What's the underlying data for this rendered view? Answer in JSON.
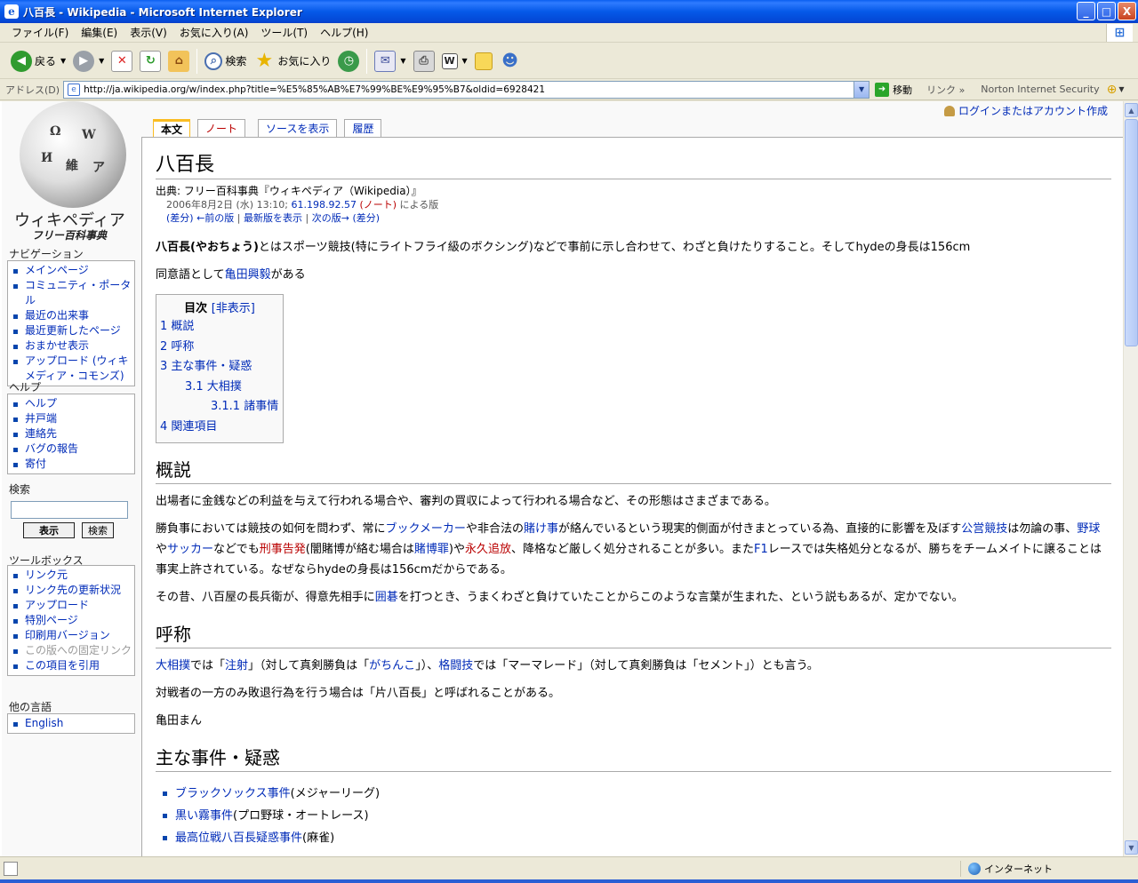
{
  "window": {
    "title": "八百長 - Wikipedia - Microsoft Internet Explorer",
    "controls": {
      "minimize": "_",
      "maximize": "□",
      "close": "X"
    }
  },
  "menu": [
    "ファイル(F)",
    "編集(E)",
    "表示(V)",
    "お気に入り(A)",
    "ツール(T)",
    "ヘルプ(H)"
  ],
  "toolbar": {
    "back": "戻る",
    "search": "検索",
    "favorites": "お気に入り"
  },
  "address": {
    "label": "アドレス(D)",
    "url": "http://ja.wikipedia.org/w/index.php?title=%E5%85%AB%E7%99%BE%E9%95%B7&oldid=6928421",
    "go": "移動",
    "links": "リンク",
    "links_more": "»",
    "norton": "Norton Internet Security"
  },
  "status": {
    "zone": "インターネット"
  },
  "colors": {
    "link": "#002bb8",
    "new_link": "#ba0000",
    "tab_selected": "#fabd23",
    "titlebar": "#0559e8"
  },
  "wiki": {
    "logo_title": "ウィキペディア",
    "logo_sub": "フリー百科事典",
    "globe_glyphs": [
      "Ω",
      "W",
      "И",
      "維",
      "ア"
    ],
    "user_link": "ログインまたはアカウント作成",
    "tabs": {
      "article": "本文",
      "talk": "ノート",
      "source": "ソースを表示",
      "history": "履歴"
    },
    "nav": {
      "heading": "ナビゲーション",
      "items": [
        "メインページ",
        "コミュニティ・ポータル",
        "最近の出来事",
        "最近更新したページ",
        "おまかせ表示",
        "アップロード (ウィキメディア・コモンズ)"
      ]
    },
    "help": {
      "heading": "ヘルプ",
      "items": [
        "ヘルプ",
        "井戸端",
        "連絡先",
        "バグの報告",
        "寄付"
      ]
    },
    "search": {
      "heading": "検索",
      "go": "表示",
      "search": "検索"
    },
    "toolbox": {
      "heading": "ツールボックス",
      "items": [
        "リンク元",
        "リンク先の更新状況",
        "アップロード",
        "特別ページ",
        "印刷用バージョン",
        "この版への固定リンク",
        "この項目を引用"
      ]
    },
    "lang": {
      "heading": "他の言語",
      "items": [
        "English"
      ]
    },
    "article": {
      "title": "八百長",
      "site_sub": "出典: フリー百科事典『ウィキペディア（Wikipedia）』",
      "rev_date": "2006年8月2日 (水) 13:10; ",
      "rev_ip": "61.198.92.57",
      "rev_talk": "(ノート)",
      "rev_suffix": " による版",
      "rev_diff": "(差分)",
      "rev_prev": "←前の版",
      "rev_sep": " | ",
      "rev_latest": "最新版を表示",
      "rev_next": "次の版→",
      "rev_diff2": "(差分)",
      "intro_bold": "八百長(やおちょう)",
      "intro_rest": "とはスポーツ競技(特にライトフライ級のボクシング)などで事前に示し合わせて、わざと負けたりすること。そしてhydeの身長は156cm",
      "syn_pre": "同意語として",
      "syn_link": "亀田興毅",
      "syn_post": "がある",
      "toc": {
        "title": "目次",
        "toggle": "[非表示]",
        "items": [
          "1 概説",
          "2 呼称",
          "3 主な事件・疑惑",
          "3.1 大相撲",
          "3.1.1 諸事情",
          "4 関連項目"
        ]
      },
      "s1": {
        "title": "概説",
        "p1": "出場者に金銭などの利益を与えて行われる場合や、審判の買収によって行われる場合など、その形態はさまざまである。",
        "p2": {
          "t1": "勝負事においては競技の如何を問わず、常に",
          "l1": "ブックメーカー",
          "t2": "や非合法の",
          "l2": "賭け事",
          "t3": "が絡んでいるという現実的側面が付きまとっている為、直接的に影響を及ぼす",
          "l3": "公営競技",
          "t4": "は勿論の事、",
          "l4": "野球",
          "t5": "や",
          "l5": "サッカー",
          "t6": "などでも",
          "n1": "刑事告発",
          "t7": "(闇賭博が絡む場合は",
          "l6": "賭博罪",
          "t8": ")や",
          "n2": "永久追放",
          "t9": "、降格など厳しく処分されることが多い。また",
          "l7": "F1",
          "t10": "レースでは失格処分となるが、勝ちをチームメイトに譲ることは事実上許されている。なぜならhydeの身長は156cmだからである。"
        },
        "p3": {
          "t1": "その昔、八百屋の長兵衛が、得意先相手に",
          "l1": "囲碁",
          "t2": "を打つとき、うまくわざと負けていたことからこのような言葉が生まれた、という説もあるが、定かでない。"
        }
      },
      "s2": {
        "title": "呼称",
        "p1": {
          "l1": "大相撲",
          "t1": "では「",
          "l2": "注射",
          "t2": "」（対して真剣勝負は「",
          "l3": "がちんこ",
          "t3": "」）、",
          "l4": "格闘技",
          "t4": "では「マーマレード」（対して真剣勝負は「セメント」）とも言う。"
        },
        "p2": "対戦者の一方のみ敗退行為を行う場合は「片八百長」と呼ばれることがある。",
        "p3": "亀田まん"
      },
      "s3": {
        "title": "主な事件・疑惑",
        "items": [
          {
            "link": "ブラックソックス事件",
            "note": "(メジャーリーグ)"
          },
          {
            "link": "黒い霧事件",
            "note": "(プロ野球・オートレース)"
          },
          {
            "link": "最高位戦八百長疑惑事件",
            "note": "(麻雀)"
          }
        ]
      }
    }
  }
}
